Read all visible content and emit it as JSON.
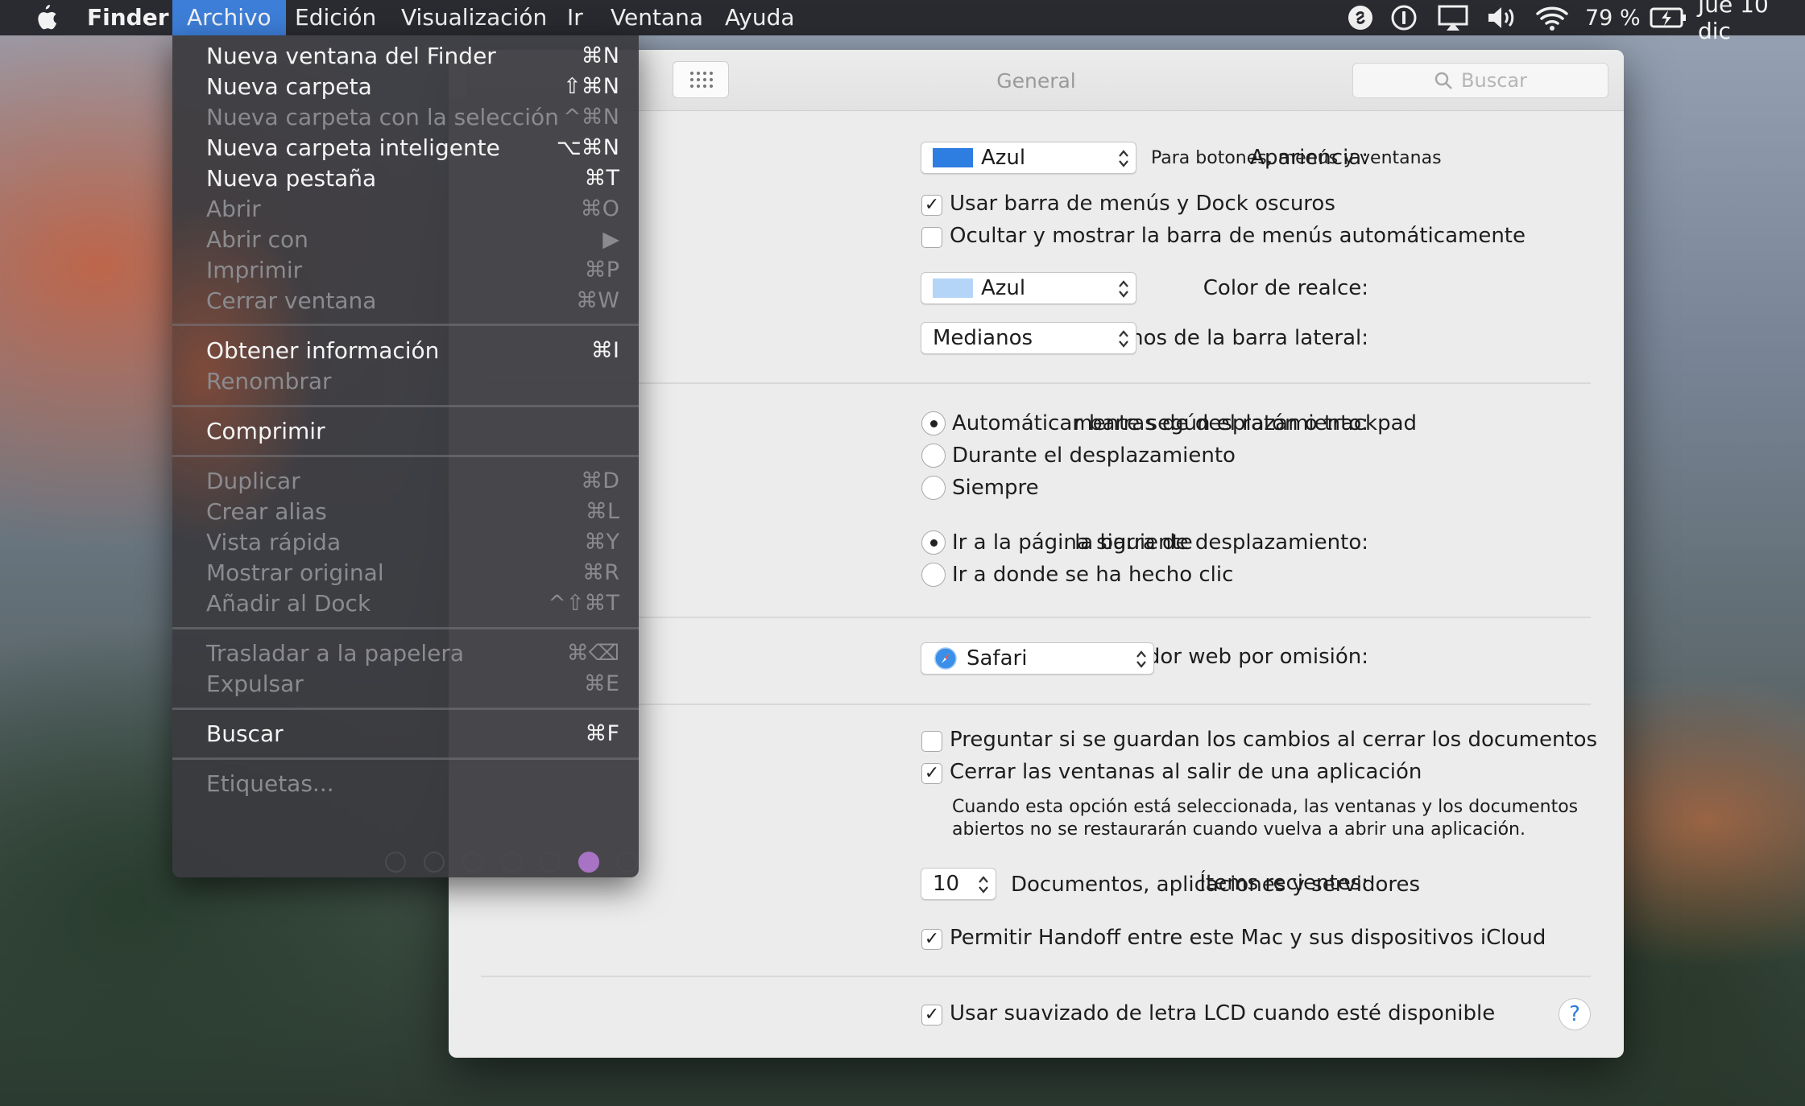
{
  "menubar": {
    "items": [
      "Finder",
      "Archivo",
      "Edición",
      "Visualización",
      "Ir",
      "Ventana",
      "Ayuda"
    ],
    "battery": "79 %",
    "clock": "Jue 10 dic"
  },
  "window": {
    "title": "General",
    "search_placeholder": "Buscar"
  },
  "prefs": {
    "appearance": {
      "label": "Apariencia:",
      "value": "Azul",
      "hint": "Para botones, menús y ventanas",
      "swatch": "#2e7de0"
    },
    "dark_menu": {
      "label": "Usar barra de menús y Dock oscuros",
      "checked": true
    },
    "autohide_menu": {
      "label": "Ocultar y mostrar la barra de menús automáticamente",
      "checked": false
    },
    "highlight": {
      "label": "Color de realce:",
      "value": "Azul",
      "swatch": "#b5d5f8"
    },
    "sidebar_icons": {
      "label": "Iconos de la barra lateral:",
      "value": "Medianos"
    },
    "scrollbars": {
      "label": "r barras de desplazamiento:",
      "options": [
        "Automáticamente según el ratón o trackpad",
        "Durante el desplazamiento",
        "Siempre"
      ],
      "selected": 0
    },
    "scroll_click": {
      "label": "la barra de desplazamiento:",
      "options": [
        "Ir a la página siguiente",
        "Ir a donde se ha hecho clic"
      ],
      "selected": 0
    },
    "browser": {
      "label": "Navegador web por omisión:",
      "value": "Safari"
    },
    "ask_save": {
      "label": "Preguntar si se guardan los cambios al cerrar los documentos",
      "checked": false
    },
    "close_windows": {
      "label": "Cerrar las ventanas al salir de una aplicación",
      "checked": true
    },
    "close_note_1": "Cuando esta opción está seleccionada, las ventanas y los documentos",
    "close_note_2": "abiertos no se restaurarán cuando vuelva a abrir una aplicación.",
    "recent": {
      "label": "Ítems recientes:",
      "value": "10",
      "hint": "Documentos, aplicaciones y servidores"
    },
    "handoff": {
      "label": "Permitir Handoff entre este Mac y sus dispositivos iCloud",
      "checked": true
    },
    "lcd": {
      "label": "Usar suavizado de letra LCD cuando esté disponible",
      "checked": true
    },
    "help": "?"
  },
  "archivo_menu": {
    "items": [
      {
        "label": "Nueva ventana del Finder",
        "key": "⌘N",
        "enabled": true
      },
      {
        "label": "Nueva carpeta",
        "key": "⇧⌘N",
        "enabled": true
      },
      {
        "label": "Nueva carpeta con la selección",
        "key": "^⌘N",
        "enabled": false
      },
      {
        "label": "Nueva carpeta inteligente",
        "key": "⌥⌘N",
        "enabled": true
      },
      {
        "label": "Nueva pestaña",
        "key": "⌘T",
        "enabled": true
      },
      {
        "label": "Abrir",
        "key": "⌘O",
        "enabled": false
      },
      {
        "label": "Abrir con",
        "key": "▶",
        "enabled": false
      },
      {
        "label": "Imprimir",
        "key": "⌘P",
        "enabled": false
      },
      {
        "label": "Cerrar ventana",
        "key": "⌘W",
        "enabled": false
      },
      {
        "label": "Obtener información",
        "key": "⌘I",
        "enabled": true
      },
      {
        "label": "Renombrar",
        "key": "",
        "enabled": false
      },
      {
        "label": "Comprimir",
        "key": "",
        "enabled": true
      },
      {
        "label": "Duplicar",
        "key": "⌘D",
        "enabled": false
      },
      {
        "label": "Crear alias",
        "key": "⌘L",
        "enabled": false
      },
      {
        "label": "Vista rápida",
        "key": "⌘Y",
        "enabled": false
      },
      {
        "label": "Mostrar original",
        "key": "⌘R",
        "enabled": false
      },
      {
        "label": "Añadir al Dock",
        "key": "^⇧⌘T",
        "enabled": false
      },
      {
        "label": "Trasladar a la papelera",
        "key": "⌘⌫",
        "enabled": false
      },
      {
        "label": "Expulsar",
        "key": "⌘E",
        "enabled": false
      },
      {
        "label": "Buscar",
        "key": "⌘F",
        "enabled": true
      },
      {
        "label": "Etiquetas...",
        "key": "",
        "enabled": false
      }
    ],
    "tag_color": "#a873c4"
  }
}
